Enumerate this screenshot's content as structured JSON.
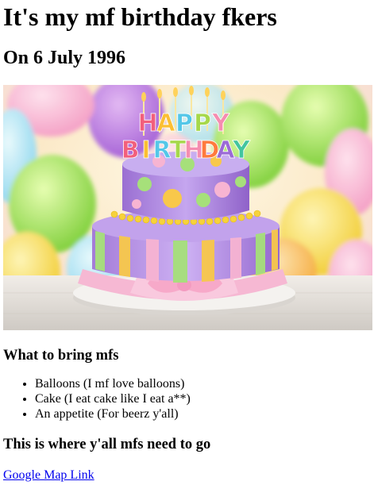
{
  "header": {
    "title": "It's my mf birthday fkers",
    "date_line": "On 6 July 1996"
  },
  "image": {
    "topper_line1": "HAPPY",
    "topper_line2": "BIRTHDAY",
    "topper_colors": [
      "#f25f7c",
      "#fbbf33",
      "#54c7e8",
      "#a6d84a",
      "#f58db0",
      "#ff7a3d",
      "#9b6ad6",
      "#43c59e"
    ]
  },
  "bring": {
    "heading": "What to bring mfs",
    "items": [
      "Balloons (I mf love balloons)",
      "Cake (I eat cake like I eat a**)",
      "An appetite (For beerz y'all)"
    ]
  },
  "location": {
    "heading": "This is where y'all mfs need to go",
    "link_label": "Google Map Link"
  },
  "colors": {
    "link": "#0000ee",
    "cake_top": "#b08ae0",
    "cake_bottom": "#a97fe0",
    "ribbon": "#f6b3cf",
    "plate": "#f2f0ee"
  }
}
